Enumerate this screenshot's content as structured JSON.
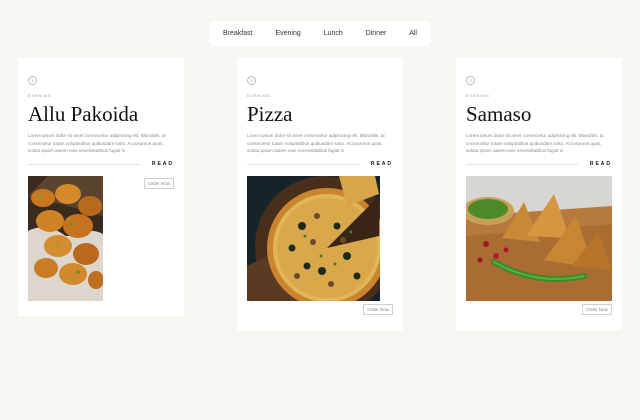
{
  "filters": [
    "Breakfast",
    "Evening",
    "Lunch",
    "Dinner",
    "All"
  ],
  "cards": [
    {
      "number": "1",
      "category": "EVENING",
      "title": "Allu Pakoida",
      "description": "Lorem ipsum dolor sit amet consectetur adipisicing elit. Blanditiis, at consectetur totam voluptatibus quibusdam iusto. Accusamus quas, soluta ipsam autem eius necessitatibus fugiat in",
      "read_label": "READ",
      "order_label": "Order Now",
      "photo_icon": "pakora-photo"
    },
    {
      "number": "2",
      "category": "EVENING",
      "title": "Pizza",
      "description": "Lorem ipsum dolor sit amet consectetur adipisicing elit. Blanditiis, at consectetur totam voluptatibus quibusdam iusto. Accusamus quas, soluta ipsam autem eius necessitatibus fugiat in",
      "read_label": "READ",
      "order_label": "Order Now",
      "photo_icon": "pizza-photo"
    },
    {
      "number": "3",
      "category": "EVENING",
      "title": "Samaso",
      "description": "Lorem ipsum dolor sit amet consectetur adipisicing elit. Blanditiis, at consectetur totam voluptatibus quibusdam iusto. Accusamus quas, soluta ipsam autem eius necessitatibus fugiat in",
      "read_label": "READ",
      "order_label": "Order Now",
      "photo_icon": "samosa-photo"
    }
  ]
}
